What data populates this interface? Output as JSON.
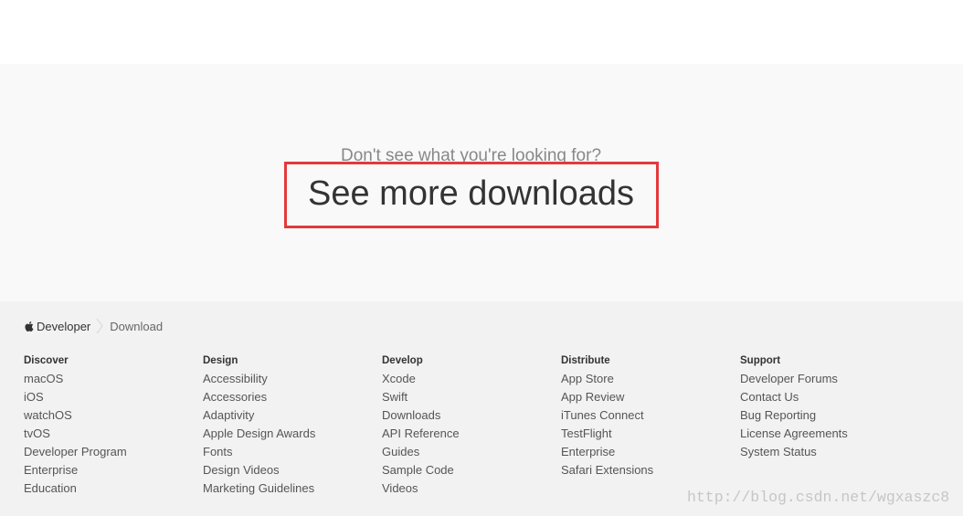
{
  "colors": {
    "page_background": "#ffffff",
    "cta_background": "#f9f9f9",
    "footer_background": "#f2f2f2",
    "annotation_border": "#e3393c",
    "heading_text": "#333333",
    "link_text": "#555555"
  },
  "cta": {
    "prompt": "Don't see what you're looking for?",
    "link_label": "See more downloads"
  },
  "breadcrumb": {
    "logo_icon": "apple-logo-icon",
    "home_label": "Developer",
    "separator_icon": "chevron-right-icon",
    "current_label": "Download"
  },
  "footer": {
    "columns": [
      {
        "heading": "Discover",
        "items": [
          "macOS",
          "iOS",
          "watchOS",
          "tvOS",
          "Developer Program",
          "Enterprise",
          "Education"
        ]
      },
      {
        "heading": "Design",
        "items": [
          "Accessibility",
          "Accessories",
          "Adaptivity",
          "Apple Design Awards",
          "Fonts",
          "Design Videos",
          "Marketing Guidelines"
        ]
      },
      {
        "heading": "Develop",
        "items": [
          "Xcode",
          "Swift",
          "Downloads",
          "API Reference",
          "Guides",
          "Sample Code",
          "Videos"
        ]
      },
      {
        "heading": "Distribute",
        "items": [
          "App Store",
          "App Review",
          "iTunes Connect",
          "TestFlight",
          "Enterprise",
          "Safari Extensions"
        ]
      },
      {
        "heading": "Support",
        "items": [
          "Developer Forums",
          "Contact Us",
          "Bug Reporting",
          "License Agreements",
          "System Status"
        ]
      }
    ]
  },
  "watermark": "http://blog.csdn.net/wgxaszc8"
}
